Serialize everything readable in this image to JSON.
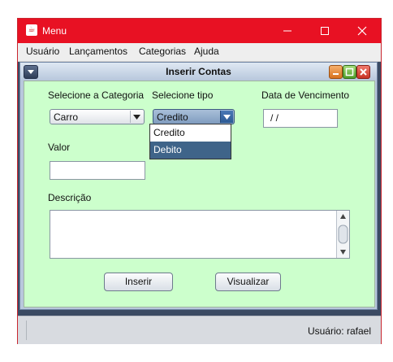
{
  "window": {
    "title": "Menu",
    "icon": "java-cup-icon"
  },
  "menubar": {
    "items": [
      "Usuário",
      "Lançamentos",
      "Categorias",
      "Ajuda"
    ]
  },
  "internal_frame": {
    "title": "Inserir Contas"
  },
  "form": {
    "categoria_label": "Selecione a Categoria",
    "categoria_value": "Carro",
    "tipo_label": "Selecione tipo",
    "tipo_value": "Credito",
    "tipo_options": [
      "Credito",
      "Debito"
    ],
    "tipo_highlighted": "Debito",
    "vencimento_label": "Data de Vencimento",
    "vencimento_value": " / /",
    "valor_label": "Valor",
    "valor_value": "",
    "descricao_label": "Descrição",
    "descricao_value": "",
    "inserir_button": "Inserir",
    "visualizar_button": "Visualizar"
  },
  "statusbar": {
    "user_text": "Usuário: rafael"
  },
  "colors": {
    "titlebar": "#e81123",
    "form_background": "#ccffcc",
    "selected_option": "#3f6489"
  }
}
